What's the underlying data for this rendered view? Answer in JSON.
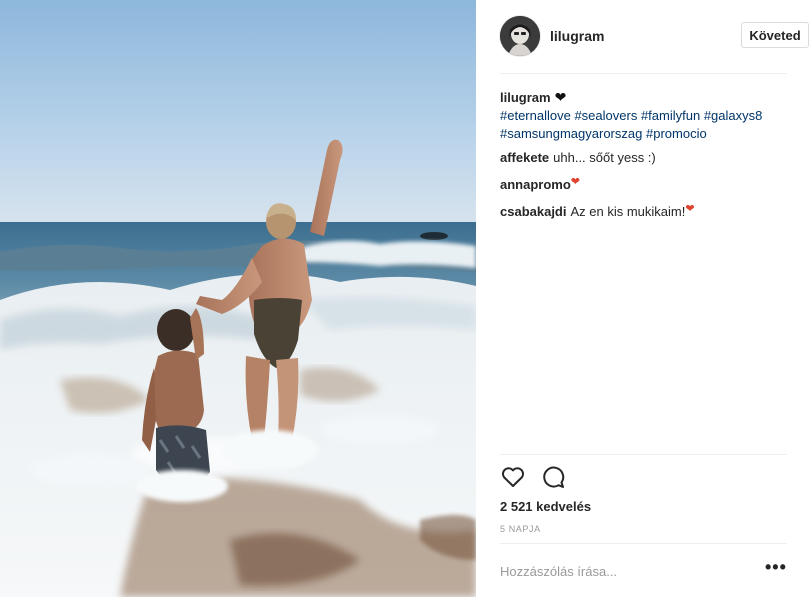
{
  "post": {
    "username": "lilugram",
    "follow_label": "Követed",
    "caption": {
      "username": "lilugram",
      "heart": "❤",
      "line1_tags": [
        "#eternallove",
        "#sealovers",
        "#familyfun",
        "#galaxys8"
      ],
      "line2_tags": [
        "#samsungmagyarorszag",
        "#promocio"
      ]
    },
    "comments": [
      {
        "user": "affekete",
        "text": "uhh... sőőt yess :)",
        "heart": ""
      },
      {
        "user": "annapromo",
        "text": "",
        "heart": "❤"
      },
      {
        "user": "csabakajdi",
        "text": "Az en kis mukikaim!",
        "heart": "❤"
      }
    ],
    "likes": "2 521 kedvelés",
    "time_ago": "5 NAPJA",
    "comment_placeholder": "Hozzászólás írása...",
    "more_icon": "•••",
    "icons": {
      "like": "heart-outline-icon",
      "comment": "speech-bubble-icon",
      "more": "ellipsis-icon"
    },
    "colors": {
      "hashtag": "#003569",
      "heart_red": "#e0442f",
      "divider": "#efefef",
      "muted": "#999999"
    }
  }
}
